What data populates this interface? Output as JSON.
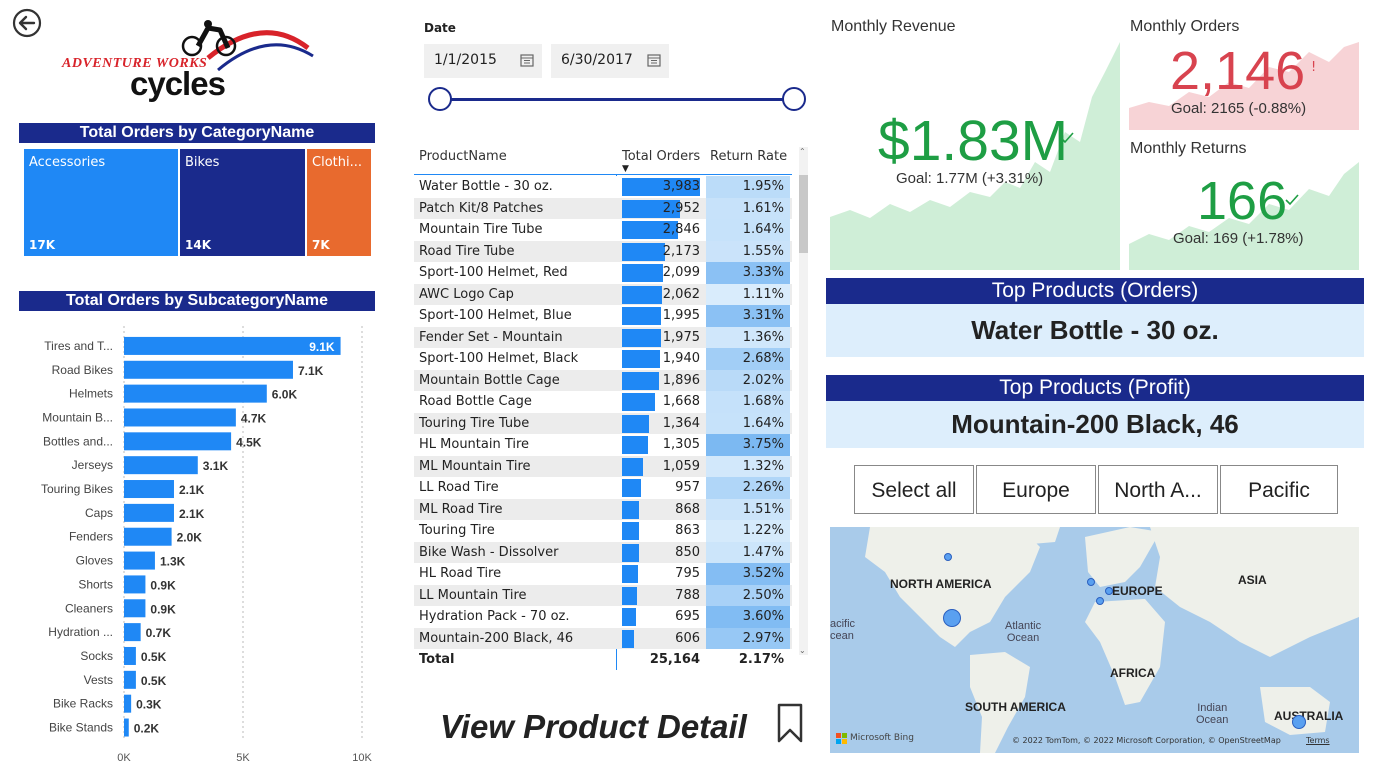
{
  "logo": {
    "line1": "ADVENTURE WORKS",
    "line2": "cycles"
  },
  "treemap": {
    "title": "Total Orders by CategoryName",
    "items": [
      {
        "label": "Accessories",
        "value": "17K",
        "color": "#1f88f5"
      },
      {
        "label": "Bikes",
        "value": "14K",
        "color": "#1a2a8c"
      },
      {
        "label": "Clothi...",
        "value": "7K",
        "color": "#e86a2e"
      }
    ]
  },
  "subcategory_chart": {
    "title": "Total Orders by SubcategoryName"
  },
  "chart_data": {
    "type": "bar",
    "orientation": "horizontal",
    "title": "Total Orders by SubcategoryName",
    "categories": [
      "Tires and T...",
      "Road Bikes",
      "Helmets",
      "Mountain B...",
      "Bottles and...",
      "Jerseys",
      "Touring Bikes",
      "Caps",
      "Fenders",
      "Gloves",
      "Shorts",
      "Cleaners",
      "Hydration ...",
      "Socks",
      "Vests",
      "Bike Racks",
      "Bike Stands"
    ],
    "values": [
      9100,
      7100,
      6000,
      4700,
      4500,
      3100,
      2100,
      2100,
      2000,
      1300,
      900,
      900,
      700,
      500,
      500,
      300,
      200
    ],
    "data_labels": [
      "9.1K",
      "7.1K",
      "6.0K",
      "4.7K",
      "4.5K",
      "3.1K",
      "2.1K",
      "2.1K",
      "2.0K",
      "1.3K",
      "0.9K",
      "0.9K",
      "0.7K",
      "0.5K",
      "0.5K",
      "0.3K",
      "0.2K"
    ],
    "xlim": [
      0,
      10000
    ],
    "xticks": [
      "0K",
      "5K",
      "10K"
    ],
    "color": "#1f88f5"
  },
  "date_filter": {
    "label": "Date",
    "start": "1/1/2015",
    "end": "6/30/2017"
  },
  "product_table": {
    "headers": [
      "ProductName",
      "Total Orders",
      "Return Rate"
    ],
    "max_orders": 3983,
    "rows": [
      {
        "name": "Water Bottle - 30 oz.",
        "orders": "3,983",
        "orders_num": 3983,
        "rate": "1.95%",
        "rate_num": 1.95
      },
      {
        "name": "Patch Kit/8 Patches",
        "orders": "2,952",
        "orders_num": 2952,
        "rate": "1.61%",
        "rate_num": 1.61
      },
      {
        "name": "Mountain Tire Tube",
        "orders": "2,846",
        "orders_num": 2846,
        "rate": "1.64%",
        "rate_num": 1.64
      },
      {
        "name": "Road Tire Tube",
        "orders": "2,173",
        "orders_num": 2173,
        "rate": "1.55%",
        "rate_num": 1.55
      },
      {
        "name": "Sport-100 Helmet, Red",
        "orders": "2,099",
        "orders_num": 2099,
        "rate": "3.33%",
        "rate_num": 3.33
      },
      {
        "name": "AWC Logo Cap",
        "orders": "2,062",
        "orders_num": 2062,
        "rate": "1.11%",
        "rate_num": 1.11
      },
      {
        "name": "Sport-100 Helmet, Blue",
        "orders": "1,995",
        "orders_num": 1995,
        "rate": "3.31%",
        "rate_num": 3.31
      },
      {
        "name": "Fender Set - Mountain",
        "orders": "1,975",
        "orders_num": 1975,
        "rate": "1.36%",
        "rate_num": 1.36
      },
      {
        "name": "Sport-100 Helmet, Black",
        "orders": "1,940",
        "orders_num": 1940,
        "rate": "2.68%",
        "rate_num": 2.68
      },
      {
        "name": "Mountain Bottle Cage",
        "orders": "1,896",
        "orders_num": 1896,
        "rate": "2.02%",
        "rate_num": 2.02
      },
      {
        "name": "Road Bottle Cage",
        "orders": "1,668",
        "orders_num": 1668,
        "rate": "1.68%",
        "rate_num": 1.68
      },
      {
        "name": "Touring Tire Tube",
        "orders": "1,364",
        "orders_num": 1364,
        "rate": "1.64%",
        "rate_num": 1.64
      },
      {
        "name": "HL Mountain Tire",
        "orders": "1,305",
        "orders_num": 1305,
        "rate": "3.75%",
        "rate_num": 3.75
      },
      {
        "name": "ML Mountain Tire",
        "orders": "1,059",
        "orders_num": 1059,
        "rate": "1.32%",
        "rate_num": 1.32
      },
      {
        "name": "LL Road Tire",
        "orders": "957",
        "orders_num": 957,
        "rate": "2.26%",
        "rate_num": 2.26
      },
      {
        "name": "ML Road Tire",
        "orders": "868",
        "orders_num": 868,
        "rate": "1.51%",
        "rate_num": 1.51
      },
      {
        "name": "Touring Tire",
        "orders": "863",
        "orders_num": 863,
        "rate": "1.22%",
        "rate_num": 1.22
      },
      {
        "name": "Bike Wash - Dissolver",
        "orders": "850",
        "orders_num": 850,
        "rate": "1.47%",
        "rate_num": 1.47
      },
      {
        "name": "HL Road Tire",
        "orders": "795",
        "orders_num": 795,
        "rate": "3.52%",
        "rate_num": 3.52
      },
      {
        "name": "LL Mountain Tire",
        "orders": "788",
        "orders_num": 788,
        "rate": "2.50%",
        "rate_num": 2.5
      },
      {
        "name": "Hydration Pack - 70 oz.",
        "orders": "695",
        "orders_num": 695,
        "rate": "3.60%",
        "rate_num": 3.6
      },
      {
        "name": "Mountain-200 Black, 46",
        "orders": "606",
        "orders_num": 606,
        "rate": "2.97%",
        "rate_num": 2.97
      }
    ],
    "total": {
      "label": "Total",
      "orders": "25,164",
      "rate": "2.17%"
    }
  },
  "view_detail": {
    "label": "View Product Detail"
  },
  "kpis": {
    "revenue": {
      "title": "Monthly Revenue",
      "value": "$1.83M",
      "goal": "Goal: 1.77M (+3.31%)",
      "status": "good"
    },
    "orders": {
      "title": "Monthly Orders",
      "value": "2,146",
      "goal": "Goal: 2165 (-0.88%)",
      "status": "bad",
      "mark": "!"
    },
    "returns": {
      "title": "Monthly Returns",
      "value": "166",
      "goal": "Goal: 169 (+1.78%)",
      "status": "good"
    }
  },
  "top_orders": {
    "title": "Top Products (Orders)",
    "value": "Water Bottle - 30 oz."
  },
  "top_profit": {
    "title": "Top Products (Profit)",
    "value": "Mountain-200 Black, 46"
  },
  "region_slicer": {
    "options": [
      "Select all",
      "Europe",
      "North A...",
      "Pacific"
    ]
  },
  "map": {
    "labels": [
      "NORTH AMERICA",
      "EUROPE",
      "ASIA",
      "AFRICA",
      "SOUTH AMERICA",
      "AUSTRALIA"
    ],
    "oceans": [
      "Atlantic\nOcean",
      "acific\ncean",
      "Indian\nOcean"
    ],
    "brand": "Microsoft Bing",
    "attribution": "© 2022 TomTom, © 2022 Microsoft Corporation, © OpenStreetMap",
    "terms": "Terms"
  },
  "colors": {
    "navy": "#1a2a8c",
    "blue": "#1f88f5",
    "green": "#1e9e44",
    "red": "#d8434f",
    "spark_green": "#cfeed7",
    "spark_red": "#f7d3d6"
  }
}
